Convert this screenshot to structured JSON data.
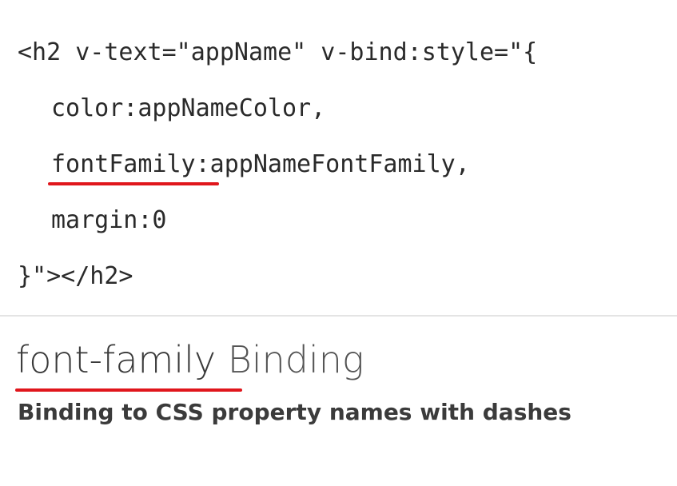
{
  "code": {
    "line1": "<h2 v-text=\"appName\" v-bind:style=\"{",
    "line2": "color:appNameColor,",
    "line3_highlight": "fontFamily",
    "line3_rest": ":appNameFontFamily,",
    "line4": "margin:0",
    "line5": "}\"></h2>"
  },
  "heading": {
    "highlight": "font-family",
    "rest": " Binding",
    "subtitle": "Binding to CSS property names with dashes"
  },
  "colors": {
    "underline": "#e0161c",
    "text": "#2a2a2a",
    "divider": "#e4e4e4"
  }
}
